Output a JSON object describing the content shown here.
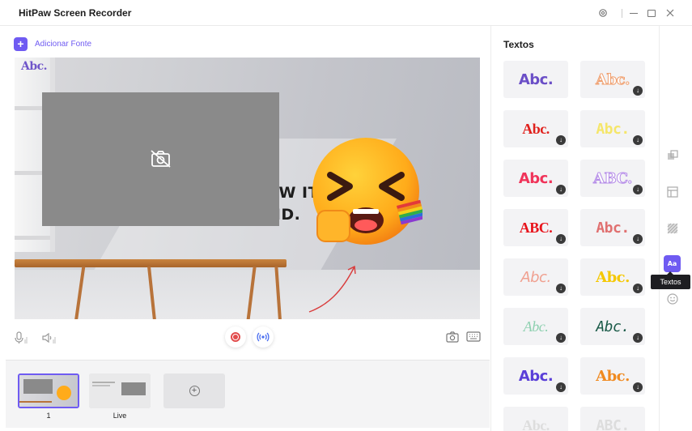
{
  "app": {
    "title": "HitPaw Screen Recorder"
  },
  "toolbar": {
    "add_source_label": "Adicionar Fonte"
  },
  "preview": {
    "logo_text": "Abc.",
    "background_text_line1": "EW IT,",
    "background_text_line2": "ND."
  },
  "scenes": [
    {
      "label": "1",
      "active": true
    },
    {
      "label": "Live",
      "active": false
    }
  ],
  "panel": {
    "title": "Textos",
    "styles": [
      {
        "text": "Abc.",
        "color": "#6b4fc7"
      },
      {
        "text": "Abc.",
        "color": "#f0a070"
      },
      {
        "text": "Abc.",
        "color": "#e0201c"
      },
      {
        "text": "Abc.",
        "color": "#f5e66a"
      },
      {
        "text": "Abc.",
        "color": "#f0345a"
      },
      {
        "text": "ABC.",
        "color": "#b58ce8"
      },
      {
        "text": "ABC.",
        "color": "#e8141c"
      },
      {
        "text": "Abc.",
        "color": "#e07070"
      },
      {
        "text": "Abc.",
        "color": "#f0a090"
      },
      {
        "text": "Abc.",
        "color": "#f5c800"
      },
      {
        "text": "Abc.",
        "color": "#8ed0b0"
      },
      {
        "text": "Abc.",
        "color": "#1a5a48"
      },
      {
        "text": "Abc.",
        "color": "#5a3fd8"
      },
      {
        "text": "Abc.",
        "color": "#f08a20"
      },
      {
        "text": "Abc.",
        "color": "#dddddd"
      },
      {
        "text": "ABC.",
        "color": "#dddddd"
      }
    ]
  },
  "sidebar": {
    "tooltip": "Textos"
  },
  "colors": {
    "accent": "#6f5bf2",
    "record": "#e24b4b"
  }
}
